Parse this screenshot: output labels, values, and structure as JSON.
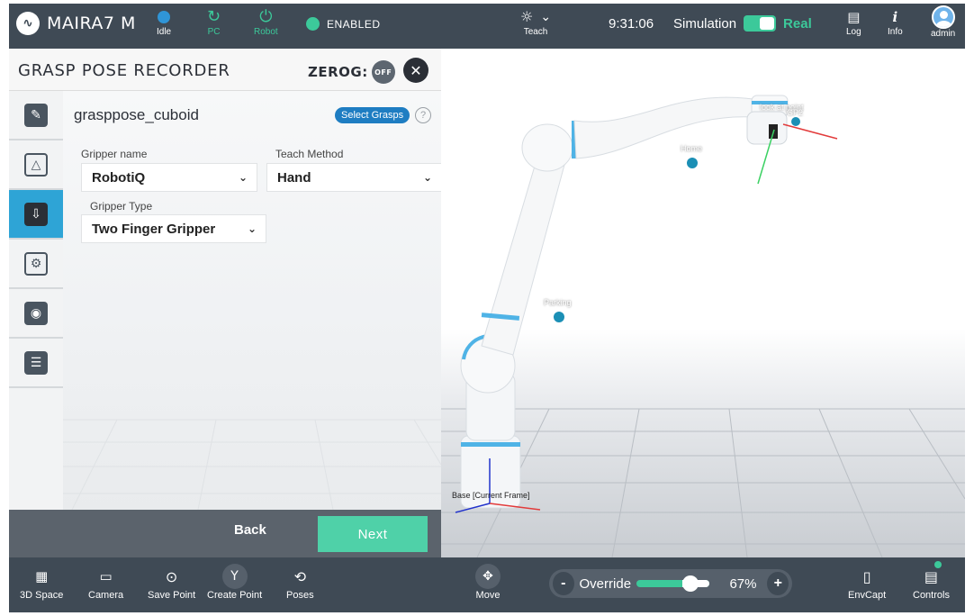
{
  "topbar": {
    "brand": "MAIRA7 M",
    "status": [
      {
        "label": "Idle"
      },
      {
        "label": "PC"
      },
      {
        "label": "Robot"
      }
    ],
    "enabled_text": "ENABLED",
    "teach_label": "Teach",
    "time": "9:31:06",
    "simulation_label": "Simulation",
    "real_label": "Real",
    "log_label": "Log",
    "info_label": "Info",
    "user_label": "admin"
  },
  "panel": {
    "title": "GRASP POSE RECORDER",
    "zerog_label": "ZEROG:",
    "zerog_state": "OFF",
    "config_name": "grasppose_cuboid",
    "select_grasps": "Select Grasps",
    "help": "?",
    "gripper_name_label": "Gripper name",
    "gripper_name_value": "RobotiQ",
    "teach_method_label": "Teach Method",
    "teach_method_value": "Hand",
    "gripper_type_label": "Gripper Type",
    "gripper_type_value": "Two Finger Gripper",
    "back_label": "Back",
    "next_label": "Next"
  },
  "viewport": {
    "labels": {
      "home": "Home",
      "parking": "Parking",
      "look_at": "look at point",
      "gp": "GP2",
      "base": "Base [Current Frame]"
    }
  },
  "bottombar": {
    "items": {
      "space": "3D Space",
      "camera": "Camera",
      "save_point": "Save Point",
      "create_point": "Create Point",
      "poses": "Poses",
      "move": "Move",
      "envcapt": "EnvCapt",
      "controls": "Controls"
    },
    "override_label": "Override",
    "override_value": "67%",
    "override_fraction": 0.67,
    "minus": "-",
    "plus": "+"
  },
  "colors": {
    "bar": "#3f4a55",
    "accent_green": "#3cc99a",
    "accent_blue": "#2ea4d6",
    "next_button": "#4fd1a8"
  }
}
